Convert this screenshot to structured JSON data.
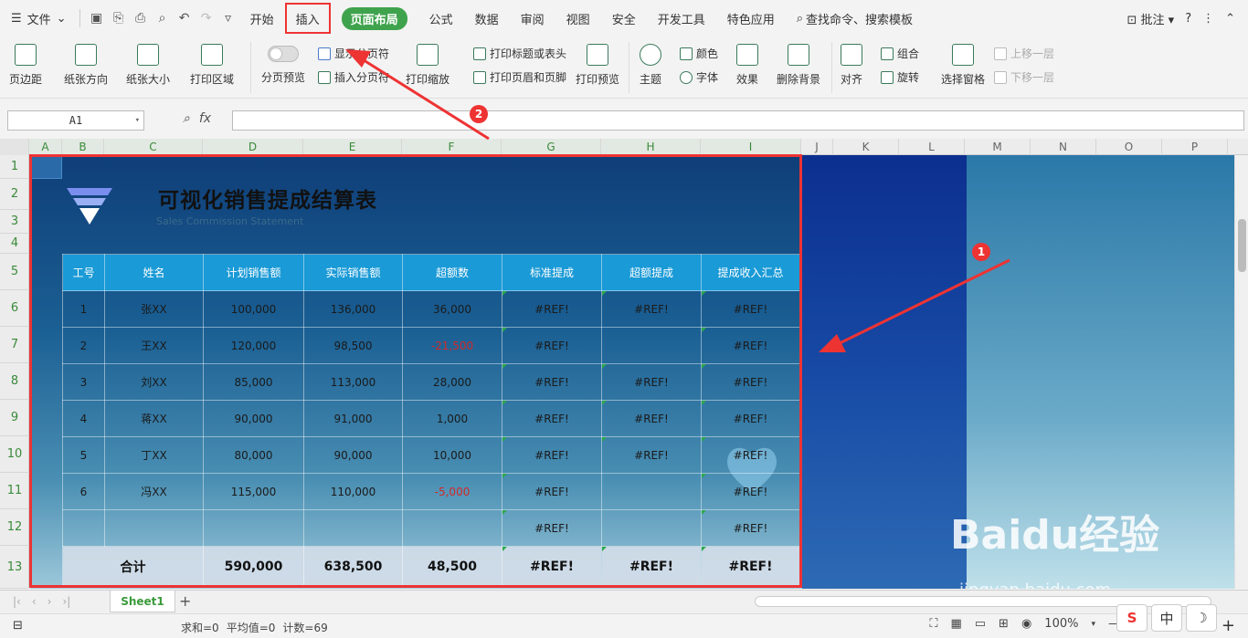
{
  "menu": {
    "file": "文件",
    "tabs": [
      "开始",
      "插入",
      "页面布局",
      "公式",
      "数据",
      "审阅",
      "视图",
      "安全",
      "开发工具",
      "特色应用"
    ],
    "active_tab": "页面布局",
    "search": "查找命令、搜索模板",
    "comment": "批注"
  },
  "ribbon": {
    "margins": "页边距",
    "orientation": "纸张方向",
    "size": "纸张大小",
    "print_area": "打印区域",
    "page_break_preview": "分页预览",
    "show_page_breaks": "显示分页符",
    "insert_page_break": "插入分页符",
    "print_scale": "打印缩放",
    "print_titles": "打印标题或表头",
    "print_header_footer": "打印页眉和页脚",
    "print_preview": "打印预览",
    "theme": "主题",
    "colors": "颜色",
    "fonts": "字体",
    "effects": "效果",
    "delete_bg": "删除背景",
    "align": "对齐",
    "group": "组合",
    "rotate": "旋转",
    "selection_pane": "选择窗格",
    "bring_forward": "上移一层",
    "send_backward": "下移一层"
  },
  "formula": {
    "namebox": "A1",
    "fx": "fx",
    "value": ""
  },
  "columns": [
    "A",
    "B",
    "C",
    "D",
    "E",
    "F",
    "G",
    "H",
    "I",
    "J",
    "K",
    "L",
    "M",
    "N",
    "O",
    "P"
  ],
  "rows": [
    "1",
    "2",
    "3",
    "4",
    "5",
    "6",
    "7",
    "8",
    "9",
    "10",
    "11",
    "12",
    "13"
  ],
  "sheet": {
    "title": "可视化销售提成结算表",
    "subtitle": "Sales Commission Statement",
    "headers": [
      "工号",
      "姓名",
      "计划销售额",
      "实际销售额",
      "超额数",
      "标准提成",
      "超额提成",
      "提成收入汇总"
    ],
    "rows": [
      [
        "1",
        "张XX",
        "100,000",
        "136,000",
        "36,000",
        "#REF!",
        "#REF!",
        "#REF!"
      ],
      [
        "2",
        "王XX",
        "120,000",
        "98,500",
        "-21,500",
        "#REF!",
        "",
        "#REF!"
      ],
      [
        "3",
        "刘XX",
        "85,000",
        "113,000",
        "28,000",
        "#REF!",
        "#REF!",
        "#REF!"
      ],
      [
        "4",
        "蒋XX",
        "90,000",
        "91,000",
        "1,000",
        "#REF!",
        "#REF!",
        "#REF!"
      ],
      [
        "5",
        "丁XX",
        "80,000",
        "90,000",
        "10,000",
        "#REF!",
        "#REF!",
        "#REF!"
      ],
      [
        "6",
        "冯XX",
        "115,000",
        "110,000",
        "-5,000",
        "#REF!",
        "",
        "#REF!"
      ],
      [
        "",
        "",
        "",
        "",
        "",
        "#REF!",
        "",
        "#REF!"
      ]
    ],
    "total": [
      "合计",
      "590,000",
      "638,500",
      "48,500",
      "#REF!",
      "#REF!",
      "#REF!"
    ]
  },
  "sheet_tab": "Sheet1",
  "status": {
    "sum": "求和=0",
    "avg": "平均值=0",
    "count": "计数=69",
    "zoom": "100%"
  },
  "ime": [
    "S",
    "中",
    "☽"
  ],
  "annotations": [
    "1",
    "2"
  ],
  "watermark": {
    "brand": "Baidu经验",
    "url": "jingyan.baidu.com"
  },
  "colors": {
    "accent": "#3fa34d",
    "annotation": "#ee3333",
    "header_blue": "#1a9ad6"
  }
}
